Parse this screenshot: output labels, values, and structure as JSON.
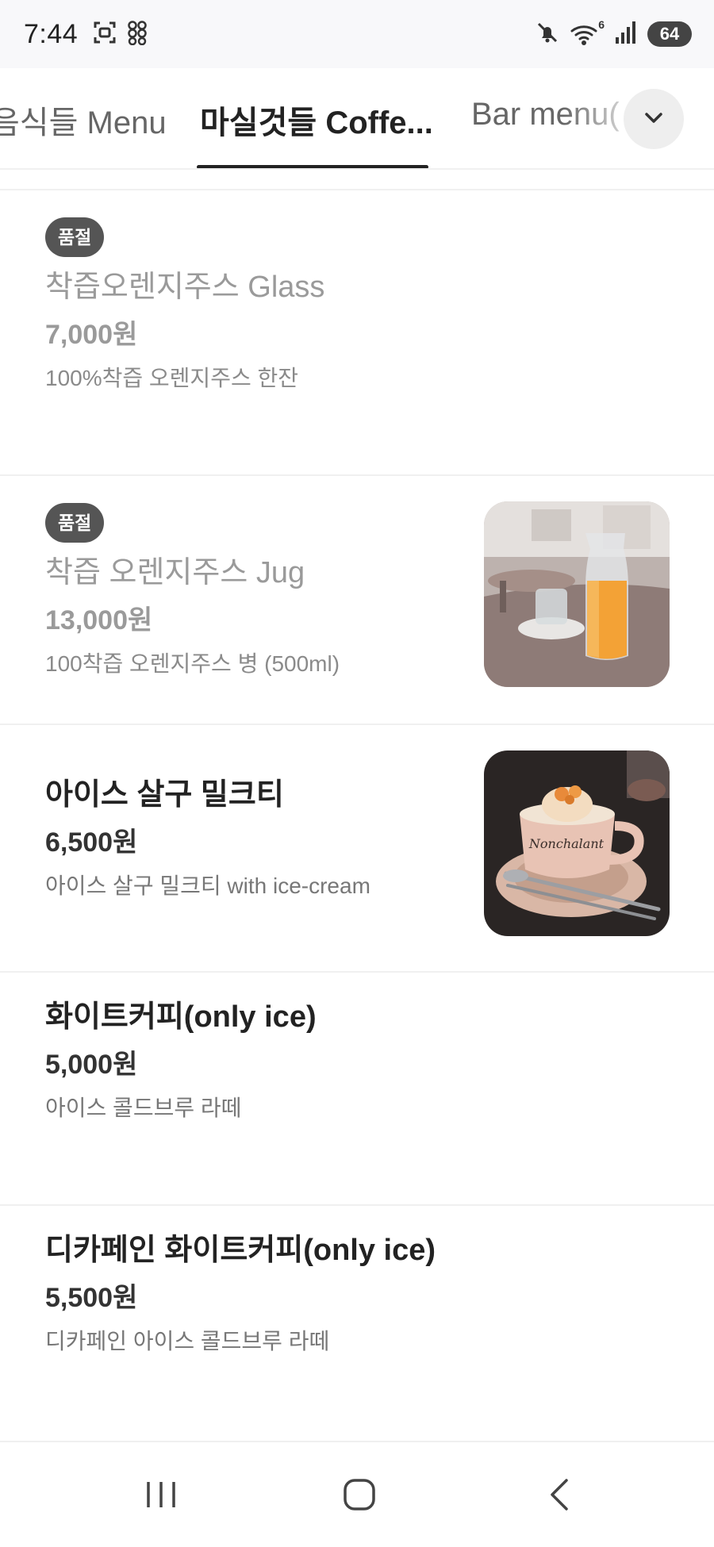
{
  "status_bar": {
    "time": "7:44",
    "left_icons": [
      "screenshot-icon",
      "link-icon"
    ],
    "right_icons": [
      "mute-icon",
      "wifi-icon",
      "signal-icon"
    ],
    "wifi_label": "6",
    "battery": "64"
  },
  "tabs": [
    {
      "label": "음식들 Menu",
      "active": false
    },
    {
      "label": "마실것들 Coffe...",
      "active": true
    },
    {
      "label": "Bar menu(",
      "active": false
    }
  ],
  "items": [
    {
      "badge": "품절",
      "name": "착즙오렌지주스 Glass",
      "price": "7,000원",
      "desc": "100%착즙 오렌지주스 한잔",
      "sold_out": true
    },
    {
      "badge": "품절",
      "name": "착즙 오렌지주스 Jug",
      "price": "13,000원",
      "desc": "100착즙 오렌지주스 병 (500ml)",
      "sold_out": true,
      "photo_text": ""
    },
    {
      "name": "아이스 살구 밀크티",
      "price": "6,500원",
      "desc": "아이스 살구 밀크티 with ice-cream",
      "sold_out": false,
      "photo_text": "Nonchalant"
    },
    {
      "name": "화이트커피(only ice)",
      "price": "5,000원",
      "desc": "아이스 콜드브루 라떼",
      "sold_out": false
    },
    {
      "name": "디카페인 화이트커피(only ice)",
      "price": "5,500원",
      "desc": "디카페인 아이스 콜드브루 라떼",
      "sold_out": false
    }
  ],
  "colors": {
    "accent": "#222222",
    "badge": "#555555",
    "sold_out_text": "#9a9a9a"
  }
}
